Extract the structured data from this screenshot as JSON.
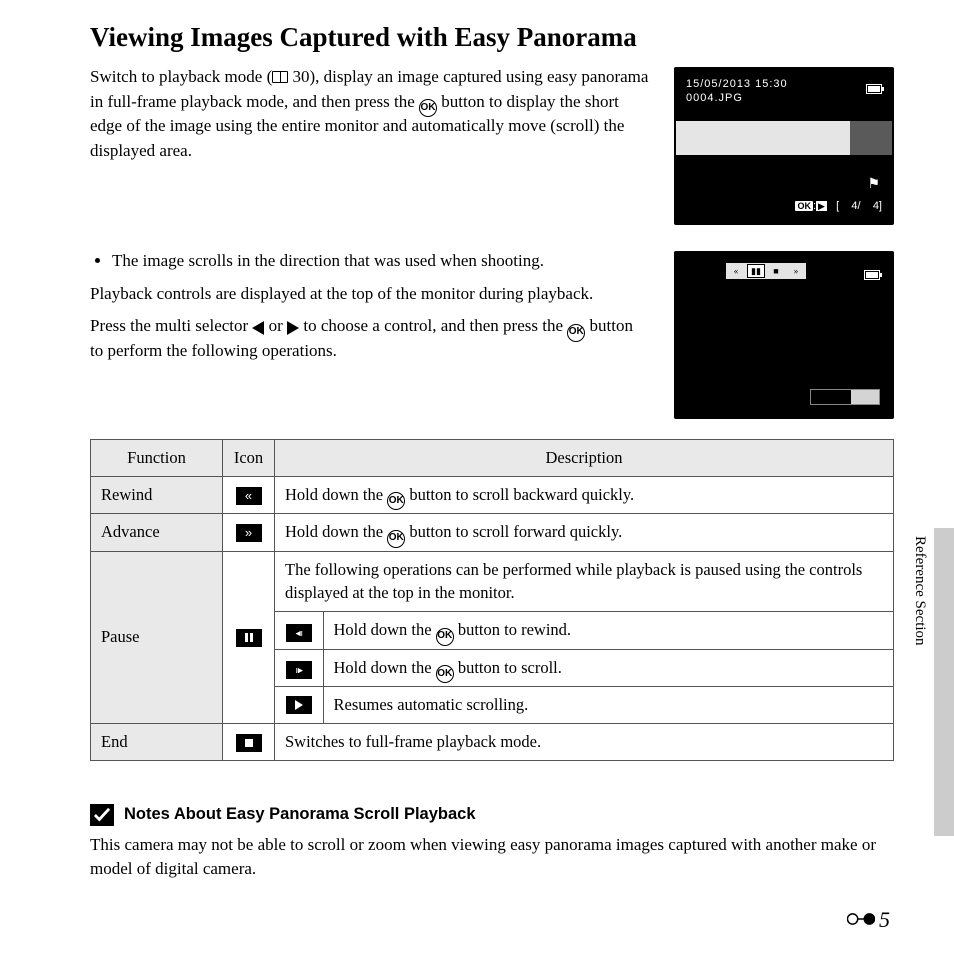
{
  "title": "Viewing Images Captured with Easy Panorama",
  "intro": {
    "p1a": "Switch to playback mode (",
    "p1b": "30), display an image captured using easy panorama in full-frame playback mode, and then press the ",
    "p1c": " button to display the short edge of the image using the entire monitor and automatically move (scroll) the displayed area."
  },
  "screen1": {
    "date": "15/05/2013 15:30",
    "file": "0004.JPG",
    "ok": "OK",
    "play": "▶",
    "counter_open": "[",
    "counter_cur": "4/",
    "counter_total": "4]"
  },
  "sec": {
    "bullet": "The image scrolls in the direction that was used when shooting.",
    "p2": "Playback controls are displayed at the top of the monitor during playback.",
    "p3a": "Press the multi selector ",
    "p3b": " or ",
    "p3c": " to choose a control, and then press the ",
    "p3d": " button to perform the following operations."
  },
  "table": {
    "h_fn": "Function",
    "h_ic": "Icon",
    "h_desc": "Description",
    "rows": {
      "rewind": {
        "fn": "Rewind",
        "desc_a": "Hold down the ",
        "desc_b": " button to scroll backward quickly."
      },
      "advance": {
        "fn": "Advance",
        "desc_a": "Hold down the ",
        "desc_b": " button to scroll forward quickly."
      },
      "pause": {
        "fn": "Pause",
        "intro": "The following operations can be performed while playback is paused using the controls displayed at the top in the monitor.",
        "r1a": "Hold down the ",
        "r1b": " button to rewind.",
        "r2a": "Hold down the ",
        "r2b": " button to scroll.",
        "r3": "Resumes automatic scrolling."
      },
      "end": {
        "fn": "End",
        "desc": "Switches to full-frame playback mode."
      }
    }
  },
  "notes": {
    "heading": "Notes About Easy Panorama Scroll Playback",
    "body": "This camera may not be able to scroll or zoom when viewing easy panorama images captured with another make or model of digital camera."
  },
  "side_label": "Reference Section",
  "page_number": "5",
  "ok_label": "OK"
}
